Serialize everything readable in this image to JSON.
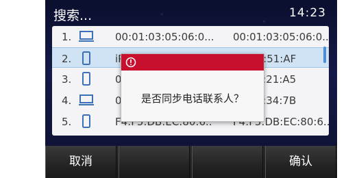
{
  "header": {
    "title": "搜索...",
    "time": "14:23"
  },
  "contacts": [
    {
      "index": "1.",
      "icon": "computer-icon",
      "name": "00:01:03:05:06:0...",
      "mac": "00:01:03:05:06:0..."
    },
    {
      "index": "2.",
      "icon": "phone-icon",
      "name": "iPh",
      "mac": "3C:35:51:AF"
    },
    {
      "index": "3.",
      "icon": "phone-icon",
      "name": "0.0",
      "mac": "52:69:21:A5"
    },
    {
      "index": "4.",
      "icon": "computer-icon",
      "name": "00",
      "mac": "59:12:34:7B"
    },
    {
      "index": "5.",
      "icon": "phone-icon",
      "name": "F4:F5:DB:EC:80:6..",
      "mac": "F4:F5:DB:EC:80:6.."
    }
  ],
  "dialog": {
    "icon": "warning-icon",
    "message": "是否同步电话联系人？"
  },
  "softkeys": {
    "cancel": "取消",
    "key2": "",
    "key3": "",
    "confirm": "确认"
  },
  "colors": {
    "accent_red": "#c8102e",
    "selection": "#cfe3f5",
    "scrollbar": "#4c8fd6"
  }
}
